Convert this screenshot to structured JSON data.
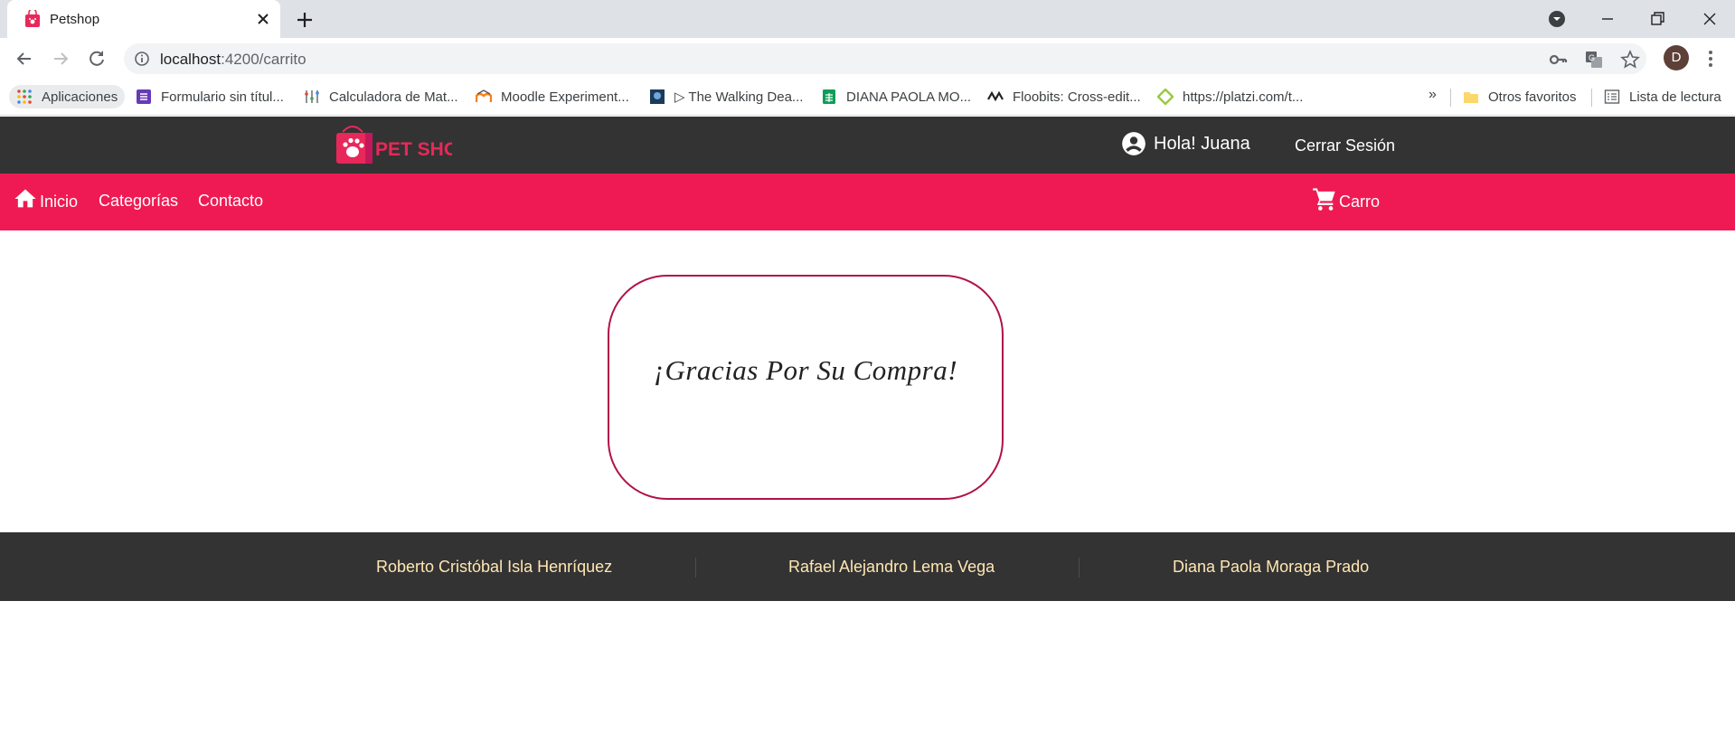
{
  "browser": {
    "tab_title": "Petshop",
    "url_host": "localhost",
    "url_path": ":4200/carrito",
    "profile_initial": "D",
    "bookmarks": [
      {
        "label": "Aplicaciones",
        "icon": "apps-grid-icon"
      },
      {
        "label": "Formulario sin títul...",
        "icon": "forms-icon"
      },
      {
        "label": "Calculadora de Mat...",
        "icon": "calculator-icon"
      },
      {
        "label": "Moodle Experiment...",
        "icon": "moodle-icon"
      },
      {
        "label": "▷ The Walking Dea...",
        "icon": "video-thumbnail-icon"
      },
      {
        "label": "DIANA PAOLA MO...",
        "icon": "sheets-icon"
      },
      {
        "label": "Floobits: Cross-edit...",
        "icon": "floobits-icon"
      },
      {
        "label": "https://platzi.com/t...",
        "icon": "platzi-icon"
      }
    ],
    "bookmarks_overflow": "»",
    "other_bookmarks": "Otros favoritos",
    "reading_list": "Lista de lectura"
  },
  "header": {
    "logo_text": "PET SHOP",
    "greeting": "Hola! Juana",
    "logout": "Cerrar Sesión"
  },
  "nav": {
    "home": "Inicio",
    "categories": "Categorías",
    "contact": "Contacto",
    "cart": "Carro"
  },
  "main": {
    "thanks_message": "¡Gracias Por Su Compra!"
  },
  "footer": {
    "authors": [
      "Roberto Cristóbal Isla Henríquez",
      "Rafael Alejandro Lema Vega",
      "Diana Paola Moraga Prado"
    ]
  },
  "colors": {
    "header_bg": "#333333",
    "nav_bg": "#ef1a53",
    "card_border": "#b0124a",
    "footer_text": "#ffe7b3"
  }
}
